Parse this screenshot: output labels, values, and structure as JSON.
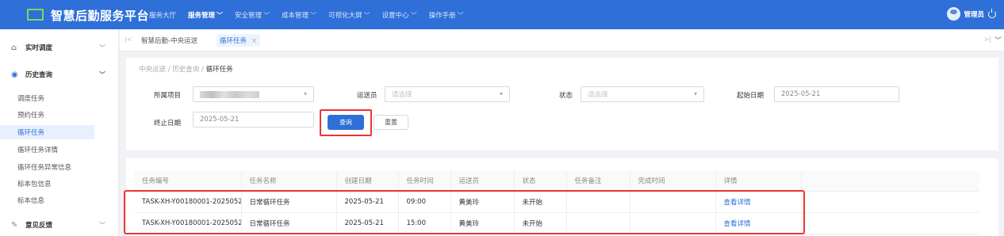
{
  "app": {
    "title": "智慧后勤服务平台",
    "logo_icon": "logo-square-icon",
    "accent_color": "#2f6fd8"
  },
  "topnav": {
    "items": [
      {
        "label": "服务大厅",
        "dropdown": ""
      },
      {
        "label": "服务管理",
        "dropdown": "﹀"
      },
      {
        "label": "安全管理",
        "dropdown": "﹀"
      },
      {
        "label": "成本管理",
        "dropdown": "﹀"
      },
      {
        "label": "可视化大屏",
        "dropdown": "﹀"
      },
      {
        "label": "设置中心",
        "dropdown": "﹀"
      },
      {
        "label": "操作手册",
        "dropdown": "﹀"
      }
    ],
    "active_index": 1
  },
  "user": {
    "name": "管理员"
  },
  "sidebar": {
    "groups": [
      {
        "label": "实时调度",
        "icon": "home-icon",
        "chevron": "﹀"
      },
      {
        "label": "历史查询",
        "icon": "search-circle-icon",
        "chevron": "﹀"
      },
      {
        "label": "意见反馈",
        "icon": "edit-icon",
        "chevron": "﹀"
      }
    ],
    "items": [
      {
        "label": "调度任务"
      },
      {
        "label": "预约任务"
      },
      {
        "label": "循环任务"
      },
      {
        "label": "循环任务详情"
      },
      {
        "label": "循环任务异常信息"
      },
      {
        "label": "标本包信息"
      },
      {
        "label": "标本信息"
      }
    ],
    "active_item": "循环任务"
  },
  "tabs": {
    "prev_icon": "|<",
    "next_icon": ">|",
    "menu_icon": "﹀",
    "items": [
      {
        "label": "智慧后勤-中央运送",
        "closable": false
      },
      {
        "label": "循环任务",
        "closable": true
      }
    ],
    "close_glyph": "×"
  },
  "breadcrumb": {
    "items": [
      "中央运送",
      "历史查询",
      "循环任务"
    ],
    "separator": "/"
  },
  "filters": {
    "project_label": "所属项目",
    "project_value": "",
    "courier_label": "运送员",
    "courier_placeholder": "请选择",
    "status_label": "状态",
    "status_placeholder": "请选择",
    "start_date_label": "起始日期",
    "start_date_value": "2025-05-21",
    "end_date_label": "终止日期",
    "end_date_value": "2025-05-21",
    "query_button": "查询",
    "reset_button": "重置"
  },
  "table": {
    "columns": [
      "任务编号",
      "任务名称",
      "创建日期",
      "任务时间",
      "运送员",
      "状态",
      "任务备注",
      "完成时间",
      "详情"
    ],
    "rows": [
      [
        "TASK-XH-Y00180001-2025052",
        "日常循环任务",
        "2025-05-21",
        "09:00",
        "黄美玲",
        "未开始",
        "",
        "",
        "查看详情"
      ],
      [
        "TASK-XH-Y00180001-2025052",
        "日常循环任务",
        "2025-05-21",
        "15:00",
        "黄美玲",
        "未开始",
        "",
        "",
        "查看详情"
      ]
    ],
    "highlight_color": "#e33"
  }
}
